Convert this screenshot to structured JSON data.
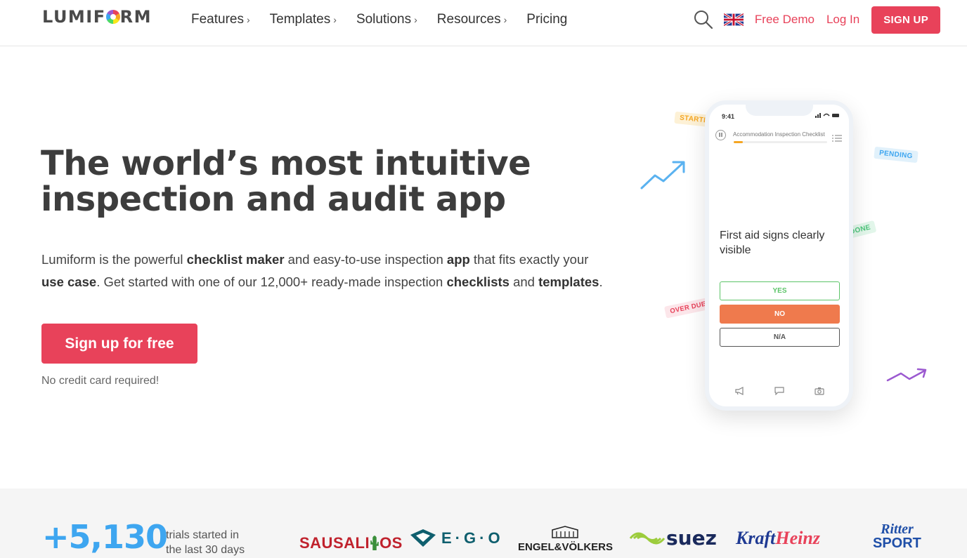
{
  "nav": {
    "logo_pre": "LUMIF",
    "logo_post": "RM",
    "menu": [
      {
        "label": "Features",
        "chevron": "›"
      },
      {
        "label": "Templates",
        "chevron": "›"
      },
      {
        "label": "Solutions",
        "chevron": "›"
      },
      {
        "label": "Resources",
        "chevron": "›"
      },
      {
        "label": "Pricing",
        "chevron": ""
      }
    ],
    "free_demo": "Free Demo",
    "log_in": "Log In",
    "sign_up": "SIGN UP"
  },
  "hero": {
    "title_line1": "The world’s most intuitive",
    "title_line2": "inspection and audit app",
    "desc": {
      "t1": "Lumiform is the powerful ",
      "b1": "checklist maker",
      "t2": " and easy-to-use inspection ",
      "b2": "app",
      "t3": " that fits exactly your ",
      "b3": "use case",
      "t4": ". Get started with one of our 12,000+ ready-made inspection ",
      "b4": "checklists",
      "t5": " and ",
      "b5": "templates",
      "t6": "."
    },
    "cta": "Sign up for free",
    "note": "No credit card required!"
  },
  "phone": {
    "time": "9:41",
    "checklist_title": "Accommodation Inspection Checklist",
    "progress": 0.1,
    "question": "First aid signs clearly visible",
    "answers": {
      "yes": "YES",
      "no": "NO",
      "na": "N/A"
    }
  },
  "tags": {
    "started": "STARTED",
    "pending": "PENDING",
    "done": "DONE",
    "overdue": "OVER DUE"
  },
  "stats": {
    "number": "+5,130",
    "text": "trials started in the last 30 days"
  },
  "brands": {
    "sausalitos": "SAUSALI",
    "sausalitos_end": "OS",
    "ego": "E·G·O",
    "engel": "ENGEL&VÖLKERS",
    "suez": "suez",
    "kraft": "Kraft",
    "heinz": "Heinz",
    "ritter": "Ritter",
    "sport": "SPORT"
  },
  "colors": {
    "accent": "#e8425a",
    "blue": "#3ea6f0",
    "orange": "#ef7a4d",
    "green": "#5cc468"
  }
}
